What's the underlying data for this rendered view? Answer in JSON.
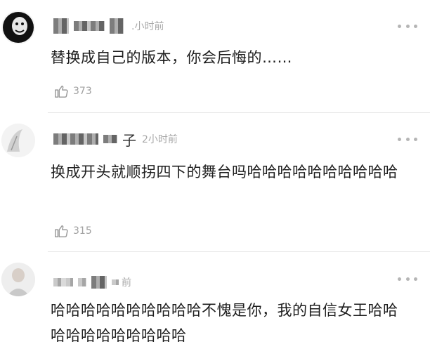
{
  "comments": [
    {
      "name_visible_char": "",
      "time": ".小时前",
      "text": "替换成自己的版本，你会后悔的……",
      "likes": "373"
    },
    {
      "name_visible_char": "子",
      "time": "2小时前",
      "text": "换成开头就顺拐四下的舞台吗哈哈哈哈哈哈哈哈哈哈",
      "likes": "315"
    },
    {
      "name_visible_char": "",
      "time": "前",
      "text": "哈哈哈哈哈哈哈哈哈哈不愧是你，我的自信女王哈哈哈哈哈哈哈哈哈哈哈",
      "likes": ""
    }
  ]
}
